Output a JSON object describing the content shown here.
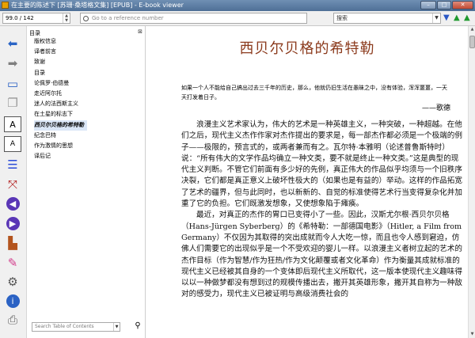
{
  "window": {
    "title": "在主要的陈述下 [苏珊·桑塔格文集] [EPUB] - E-book viewer",
    "minimize": "–",
    "maximize": "□",
    "close": "✕"
  },
  "navbar": {
    "page_value": "99.0  /  142",
    "reference_placeholder": "Go to a reference number",
    "search_value": "搜索"
  },
  "toolbar": {
    "icons": [
      "back-icon",
      "forward-icon",
      "library-icon",
      "copy-icon",
      "font-larger-icon",
      "font-smaller-icon",
      "toc-icon",
      "fullscreen-icon",
      "previous-page-icon",
      "next-page-icon",
      "reference-mode-icon",
      "theme-icon",
      "preferences-icon",
      "info-icon",
      "print-icon"
    ]
  },
  "toc": {
    "header": "目录",
    "close": "⊠",
    "items": [
      "版权信息",
      "译者前言",
      "致谢",
      "目录",
      "论佩罗·伯德曼",
      "走近阿尔托",
      "迷人的法西斯主义",
      "在土星的标志下",
      "西贝尔贝格的希特勒",
      "纪念巴特",
      "作为激情的思想",
      "译后记"
    ],
    "selected_index": 8,
    "search_placeholder": "Search Table of Contents"
  },
  "content": {
    "title": "西贝尔贝格的希特勒",
    "epigraph": "如果一个人不能给自己搞出过去三千年的历史，那么，他就仍旧生活在愚昧之中，没有体验，浑浑噩噩，一天天打发着日子。",
    "epigraph_author": "——歌德",
    "paragraphs": [
      "浪漫主义艺术家认为，伟大的艺术是一种英雄主义，一种突破，一种超越。在他们之后，现代主义杰作作家对杰作提出的要求是，每一部杰作都必须是一个极端的例子——极限的，预言式的，或两者兼而有之。瓦尔特·本雅明（论述普鲁斯特时）说：“所有伟大的文学作品均确立一种文类，要不就是终止一种文类。”这是典型的现代主义判断。不管它们前面有多少好的先例，真正伟大的作品似乎均须与一个旧秩序决裂，它们都是真正意义上破坏性极大的（如果也是有益的）举动。这样的作品拓宽了艺术的疆界，但与此同时，也以新新的、自觉的标准使得艺术行当变得复杂化并加重了它的负担。它们既激发想象，又使想象陷于瘫痪。",
      "最近，对真正的杰作的胃口已变得小了一些。因此，汉斯尤尔根·西贝尔贝格（Hans-Jürgen Syberberg）的《希特勒：一部德国电影》（Hitler, a Film from Germany）不仅因为其取得的突出成就而令人大吃一惊，而且也令人感到窘迫，仿佛人们需要它的出现似乎是一个不受欢迎的婴儿一样。以浪漫主义者树立起的艺术的杰作目标（作为智慧/作为狂热/作为文化颠覆或者文化革命）作为衡量其成就标准的现代主义已经被其自身的一个变体即后现代主义所取代，这一版本使现代主义趣味得以以一种做梦都没有想到过的规模传播出去，撇开其英雄形象，撇开其自称为一种敌对的感受力，现代主义已被证明与高级消费社会的"
    ]
  },
  "scrollbar": {
    "up": "▲",
    "down": "▼"
  }
}
